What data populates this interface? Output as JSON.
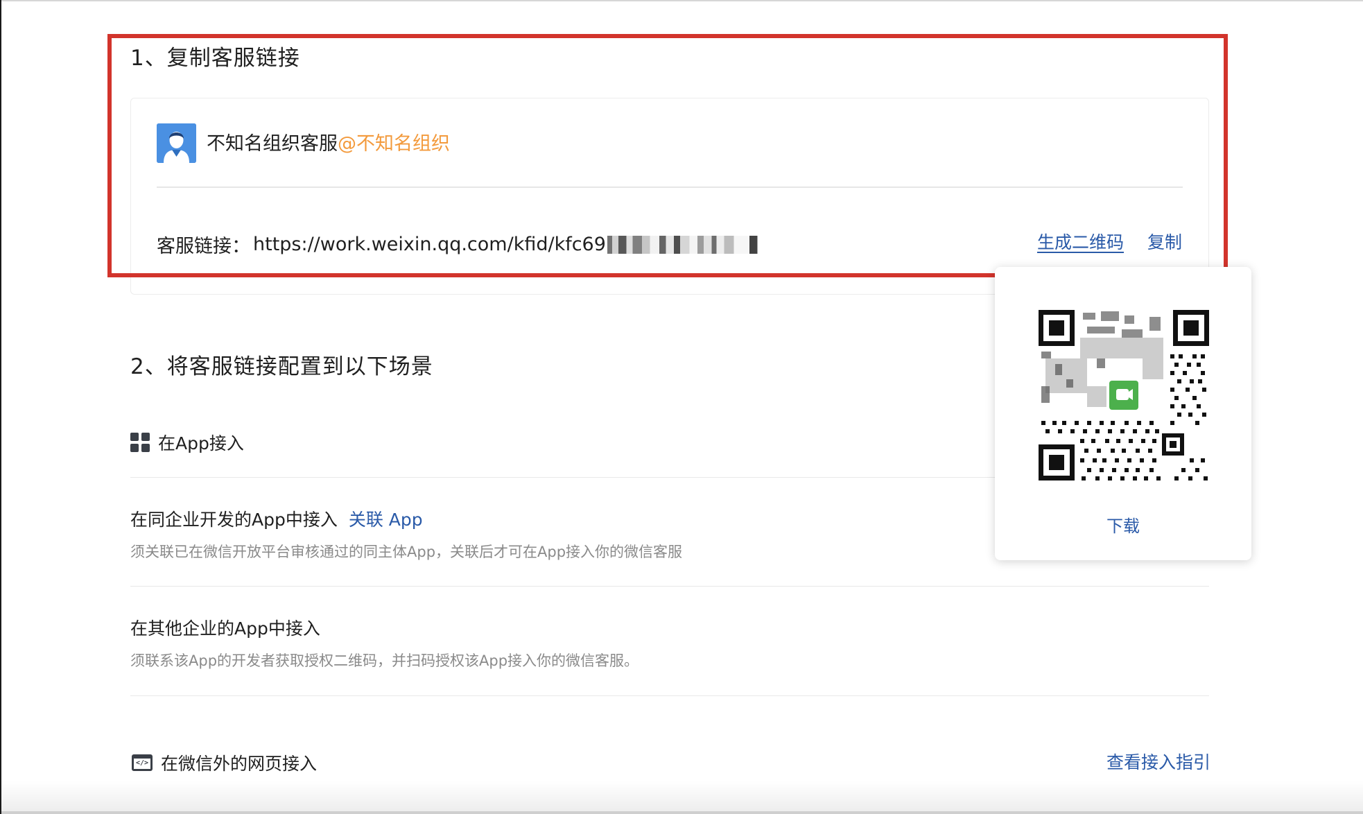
{
  "section1": {
    "title": "1、复制客服链接",
    "agent_name": "不知名组织客服",
    "agent_org": "@不知名组织",
    "link_label": "客服链接：",
    "link_url": "https://work.weixin.qq.com/kfid/kfc69",
    "generate_qr_label": "生成二维码",
    "copy_label": "复制"
  },
  "qr_popup": {
    "download_label": "下载"
  },
  "section2": {
    "title": "2、将客服链接配置到以下场景",
    "app_section_label": "在App接入",
    "options": [
      {
        "title": "在同企业开发的App中接入",
        "link_label": "关联 App",
        "desc": "须关联已在微信开放平台审核通过的同主体App，关联后才可在App接入你的微信客服"
      },
      {
        "title": "在其他企业的App中接入",
        "desc": "须联系该App的开发者获取授权二维码，并扫码授权该App接入你的微信客服。"
      }
    ],
    "web_section_label": "在微信外的网页接入",
    "guide_link_label": "查看接入指引"
  },
  "colors": {
    "accent_link": "#2a5aa8",
    "org_orange": "#f39a3c",
    "highlight_red": "#d2342c",
    "qr_center_green": "#4cb04c"
  }
}
